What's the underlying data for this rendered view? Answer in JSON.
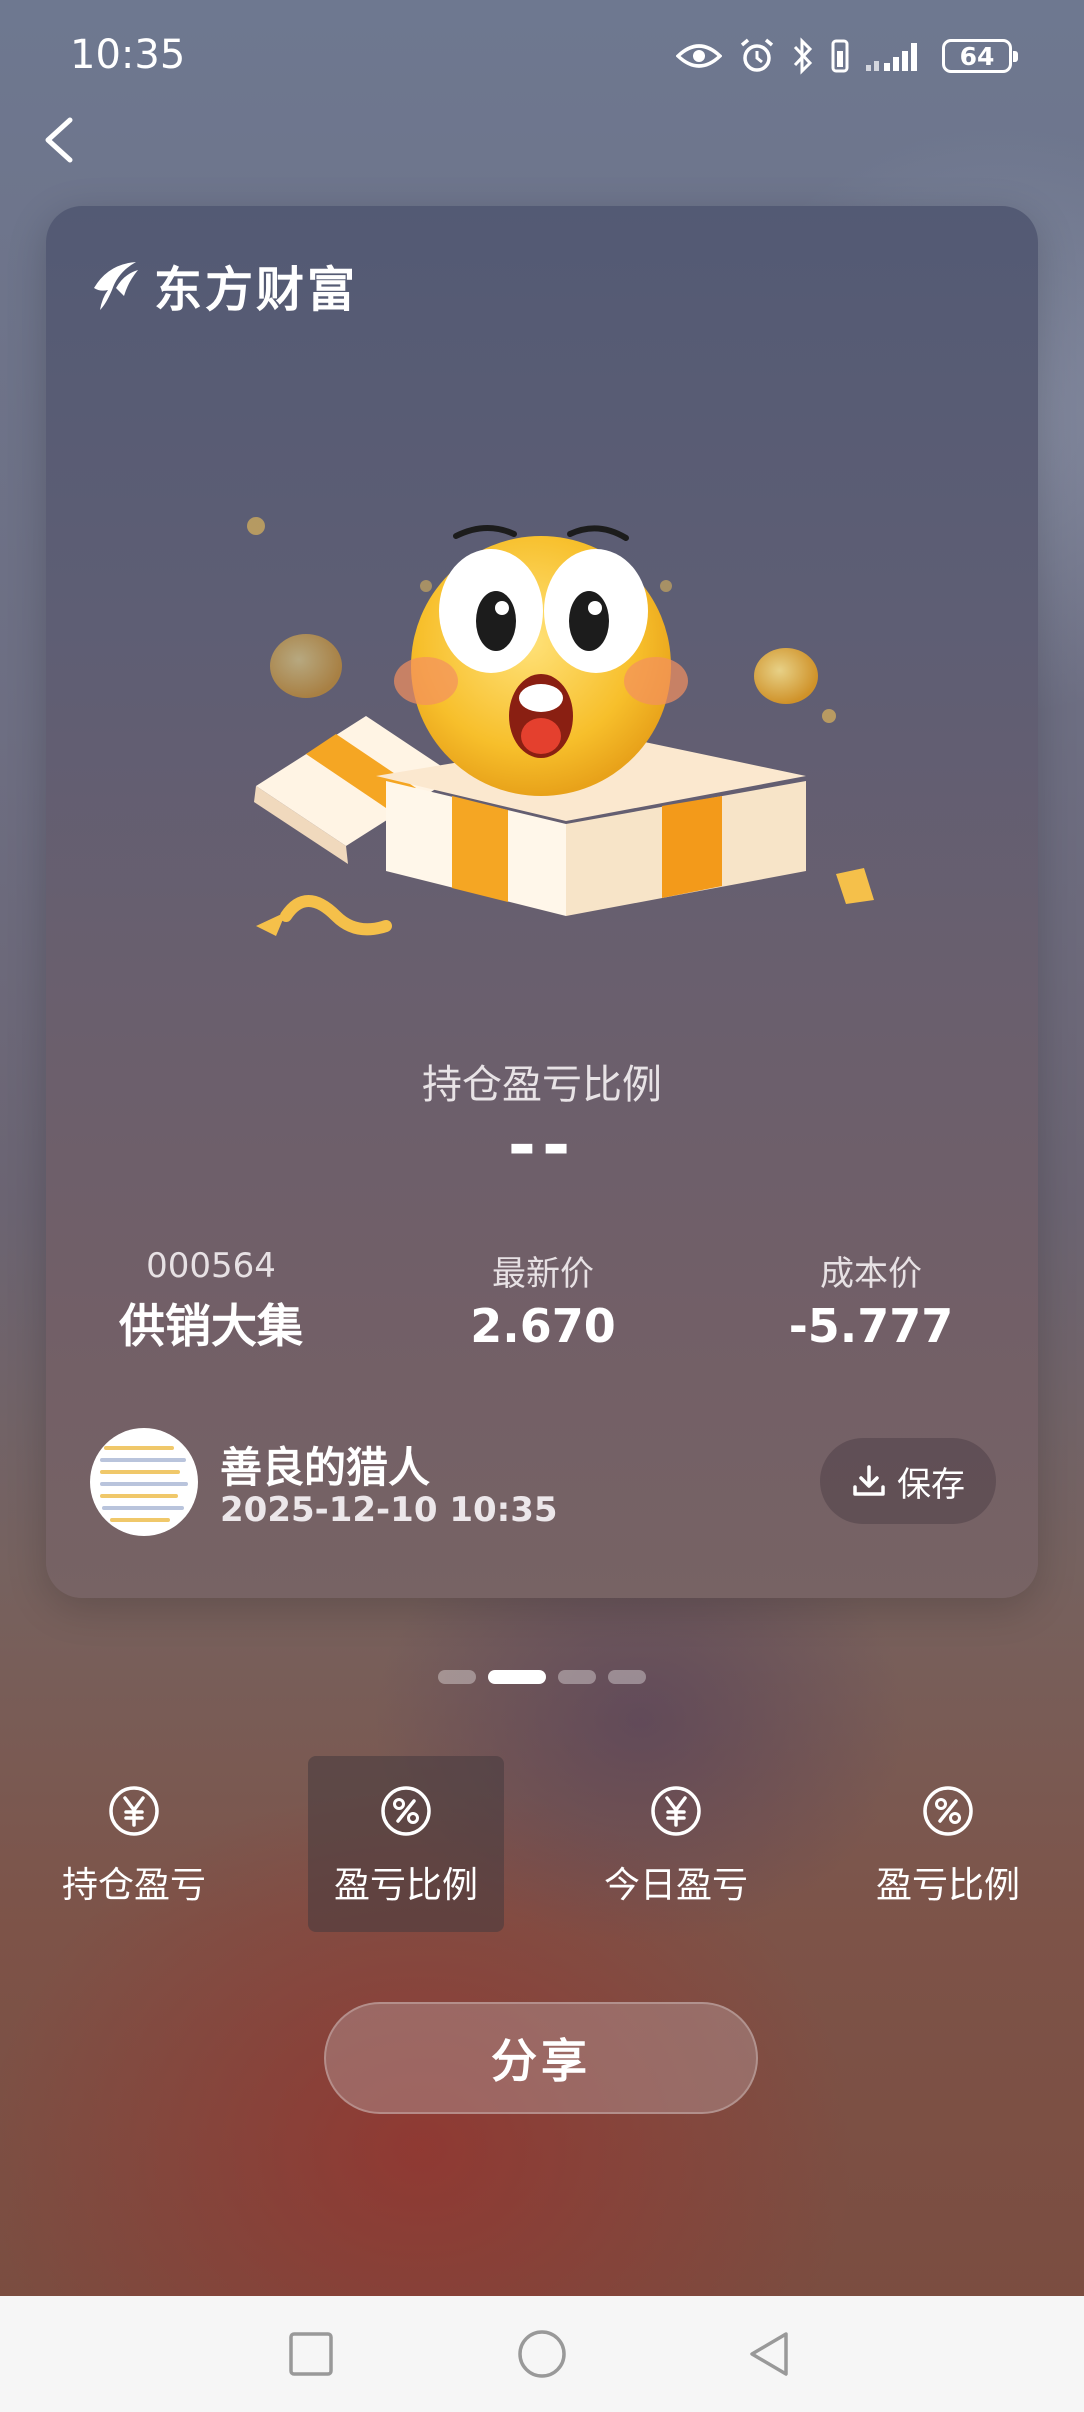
{
  "status_bar": {
    "time": "10:35",
    "battery": "64",
    "icons": [
      "eye-icon",
      "alarm-icon",
      "bluetooth-icon",
      "vibrate-icon",
      "signal-icon",
      "battery-icon"
    ]
  },
  "nav": {
    "back_icon": "chevron-left-icon"
  },
  "card": {
    "brand": "东方财富",
    "metric_label": "持仓盈亏比例",
    "metric_value": "--",
    "stock": {
      "code": "000564",
      "name": "供销大集"
    },
    "latest_price": {
      "label": "最新价",
      "value": "2.670"
    },
    "cost_price": {
      "label": "成本价",
      "value": "-5.777"
    },
    "user": {
      "name": "善良的猎人",
      "datetime": "2025-12-10 10:35"
    },
    "save_label": "保存"
  },
  "pager": {
    "count": 4,
    "active": 1
  },
  "tabs": [
    {
      "label": "持仓盈亏",
      "icon": "yen-icon"
    },
    {
      "label": "盈亏比例",
      "icon": "percent-icon",
      "selected": true
    },
    {
      "label": "今日盈亏",
      "icon": "yen-icon"
    },
    {
      "label": "盈亏比例",
      "icon": "percent-icon"
    }
  ],
  "share_label": "分享",
  "colors": {
    "accent_gold": "#f5b125",
    "card_top": "#535a74",
    "card_bottom": "#776364"
  }
}
